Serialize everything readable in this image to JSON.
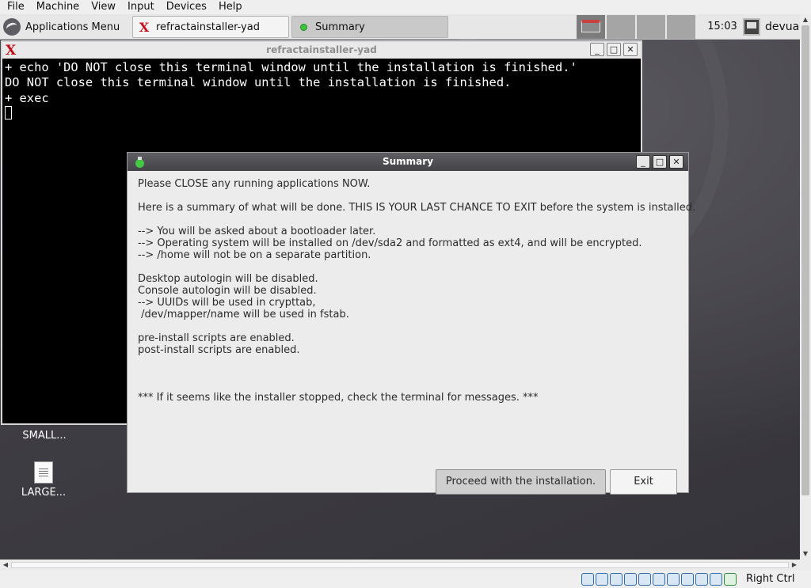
{
  "vbox_menu": [
    "File",
    "Machine",
    "View",
    "Input",
    "Devices",
    "Help"
  ],
  "panel": {
    "app_menu_label": "Applications Menu",
    "tasks": [
      {
        "label": "refractainstaller-yad",
        "icon": "x-terminal-icon"
      },
      {
        "label": "Summary",
        "icon": "bulb-icon"
      }
    ],
    "clock": "15:03",
    "user": "devua"
  },
  "terminal": {
    "title": "refractainstaller-yad",
    "lines": [
      "+ echo 'DO NOT close this terminal window until the installation is finished.'",
      "DO NOT close this terminal window until the installation is finished.",
      "+ exec"
    ]
  },
  "desktop_icons": [
    {
      "label": "SMALL..."
    },
    {
      "label": "LARGE..."
    }
  ],
  "summary": {
    "title": "Summary",
    "paragraphs": [
      [
        "Please CLOSE any running applications NOW."
      ],
      [
        "Here is a summary of what will be done. THIS IS YOUR LAST CHANCE TO EXIT before the system is installed."
      ],
      [
        "--> You will be asked about a bootloader later.",
        "--> Operating system will be installed on /dev/sda2 and formatted as ext4, and will be encrypted.",
        "--> /home will not be on a separate partition."
      ],
      [
        "Desktop autologin will be disabled.",
        "Console autologin will be disabled.",
        "--> UUIDs will be used in crypttab,",
        " /dev/mapper/name will be used in fstab."
      ],
      [
        "pre-install scripts are enabled.",
        "post-install scripts are enabled."
      ],
      [
        ""
      ],
      [
        "*** If it seems like the installer stopped, check the terminal for messages. ***"
      ]
    ],
    "proceed_label": "Proceed with the installation.",
    "exit_label": "Exit"
  },
  "statusbar": {
    "host_key": "Right Ctrl"
  }
}
